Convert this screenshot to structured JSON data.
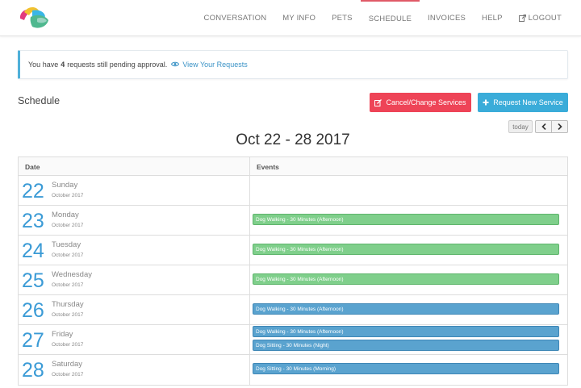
{
  "nav": {
    "items": [
      {
        "label": "CONVERSATION"
      },
      {
        "label": "MY INFO"
      },
      {
        "label": "PETS"
      },
      {
        "label": "SCHEDULE",
        "active": true
      },
      {
        "label": "INVOICES"
      },
      {
        "label": "HELP"
      },
      {
        "label": "LOGOUT",
        "icon": "logout-icon"
      }
    ],
    "active_color": "#e05a67"
  },
  "alert": {
    "prefix": "You have",
    "count": "4",
    "suffix": "requests still pending approval.",
    "link": "View Your Requests",
    "link_icon": "eye-icon",
    "accent": "#4fb0d9"
  },
  "schedule": {
    "title": "Schedule",
    "cancel_label": "Cancel/Change Services",
    "cancel_icon": "edit-icon",
    "cancel_color": "#ee4457",
    "request_label": "Request New Service",
    "request_icon": "plus-icon",
    "request_color": "#3aacd9",
    "today_label": "today",
    "prev_icon": "chevron-left-icon",
    "next_icon": "chevron-right-icon",
    "week_title": "Oct 22 - 28 2017"
  },
  "table": {
    "headers": [
      "Date",
      "Events"
    ],
    "rows": [
      {
        "day": "22",
        "name": "Sunday",
        "month": "October 2017",
        "events": []
      },
      {
        "day": "23",
        "name": "Monday",
        "month": "October 2017",
        "events": [
          {
            "label": "Dog Walking - 30 Minutes (Afternoon)",
            "color": "green"
          }
        ]
      },
      {
        "day": "24",
        "name": "Tuesday",
        "month": "October 2017",
        "events": [
          {
            "label": "Dog Walking - 30 Minutes (Afternoon)",
            "color": "green"
          }
        ]
      },
      {
        "day": "25",
        "name": "Wednesday",
        "month": "October 2017",
        "events": [
          {
            "label": "Dog Walking - 30 Minutes (Afternoon)",
            "color": "green"
          }
        ]
      },
      {
        "day": "26",
        "name": "Thursday",
        "month": "October 2017",
        "events": [
          {
            "label": "Dog Walking - 30 Minutes (Afternoon)",
            "color": "blue"
          }
        ]
      },
      {
        "day": "27",
        "name": "Friday",
        "month": "October 2017",
        "events": [
          {
            "label": "Dog Walking - 30 Minutes (Afternoon)",
            "color": "blue"
          },
          {
            "label": "Dog Sitting - 30 Minutes (Night)",
            "color": "blue"
          }
        ]
      },
      {
        "day": "28",
        "name": "Saturday",
        "month": "October 2017",
        "events": [
          {
            "label": "Dog Sitting - 30 Minutes (Morning)",
            "color": "blue"
          }
        ]
      }
    ],
    "day_number_color": "#3b9bd6",
    "event_colors": {
      "green": "#7fcf8b",
      "blue": "#5aa3cf"
    }
  }
}
